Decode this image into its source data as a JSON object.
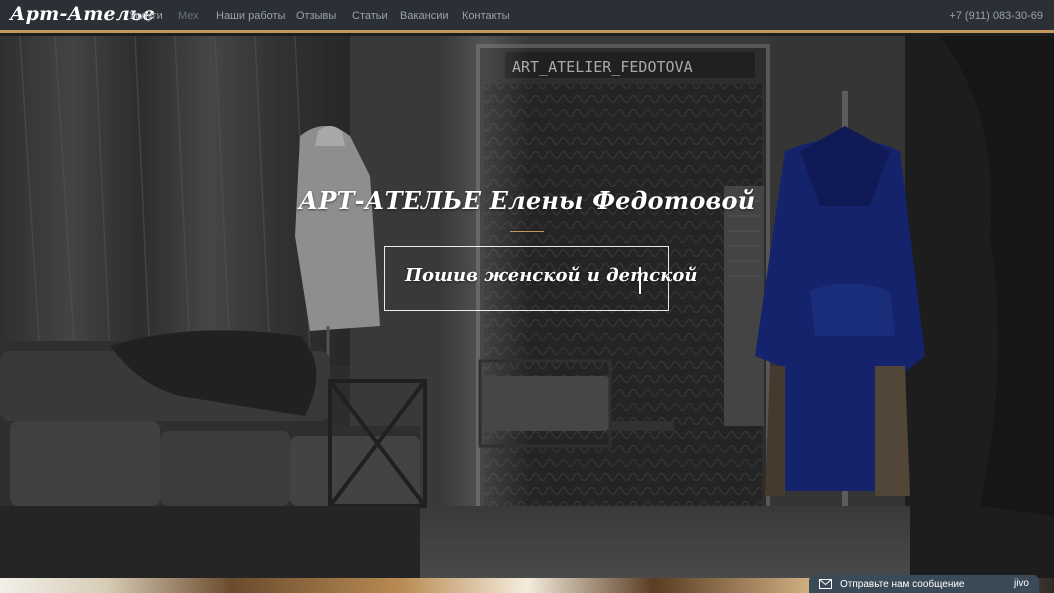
{
  "navbar": {
    "brand": "Арт-Ателье",
    "items": [
      {
        "label": "Услуги"
      },
      {
        "label": "Мех"
      },
      {
        "label": "Наши работы"
      },
      {
        "label": "Отзывы"
      },
      {
        "label": "Статьи"
      },
      {
        "label": "Вакансии"
      },
      {
        "label": "Контакты"
      }
    ],
    "phone": "+7 (911) 083-30-69"
  },
  "hero": {
    "title": "АРТ-АТЕЛЬЕ Елены Федотовой",
    "typed_text": "Пошив женской и детской",
    "sign_text": "ART_ATELIER_FEDOTOVA"
  },
  "chat": {
    "label": "Отправьте нам сообщение",
    "brand": "jivo",
    "icon": "envelope-icon"
  },
  "colors": {
    "accent": "#c39a5c",
    "navbar_bg": "#2b3036",
    "chat_bg": "#3b4a57"
  }
}
